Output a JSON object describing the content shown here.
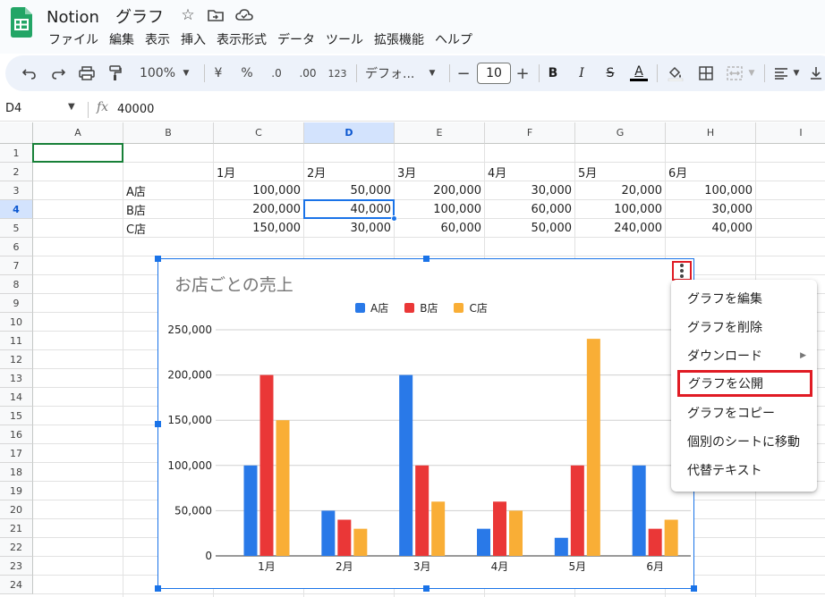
{
  "app": {
    "title": "Notion　グラフ",
    "menu": [
      "ファイル",
      "編集",
      "表示",
      "挿入",
      "表示形式",
      "データ",
      "ツール",
      "拡張機能",
      "ヘルプ"
    ]
  },
  "toolbar": {
    "zoom": "100%",
    "currency": "¥",
    "percent": "%",
    "dec_decrease": ".0",
    "dec_increase": ".00",
    "number_format": "123",
    "font": "デフォ...",
    "font_size": "10",
    "minus": "−",
    "plus": "+",
    "bold": "B",
    "italic": "I",
    "strike": "S",
    "text_color": "A"
  },
  "formula_bar": {
    "cell_ref": "D4",
    "fx": "fx",
    "value": "40000"
  },
  "sheet": {
    "columns": [
      "A",
      "B",
      "C",
      "D",
      "E",
      "F",
      "G",
      "H",
      "I"
    ],
    "rows": [
      "1",
      "2",
      "3",
      "4",
      "5",
      "6",
      "7",
      "8",
      "9",
      "10",
      "11",
      "12",
      "13",
      "14",
      "15",
      "16",
      "17",
      "18",
      "19",
      "20",
      "21",
      "22",
      "23",
      "24"
    ],
    "header_row": [
      "1月",
      "2月",
      "3月",
      "4月",
      "5月",
      "6月"
    ],
    "data_rows": [
      {
        "label": "A店",
        "values": [
          "100,000",
          "50,000",
          "200,000",
          "30,000",
          "20,000",
          "100,000"
        ]
      },
      {
        "label": "B店",
        "values": [
          "200,000",
          "40,000",
          "100,000",
          "60,000",
          "100,000",
          "30,000"
        ]
      },
      {
        "label": "C店",
        "values": [
          "150,000",
          "30,000",
          "60,000",
          "50,000",
          "240,000",
          "40,000"
        ]
      }
    ]
  },
  "chart_data": {
    "type": "bar",
    "title": "お店ごとの売上",
    "categories": [
      "1月",
      "2月",
      "3月",
      "4月",
      "5月",
      "6月"
    ],
    "series": [
      {
        "name": "A店",
        "values": [
          100000,
          50000,
          200000,
          30000,
          20000,
          100000
        ],
        "color": "#2979e8"
      },
      {
        "name": "B店",
        "values": [
          200000,
          40000,
          100000,
          60000,
          100000,
          30000
        ],
        "color": "#ea3737"
      },
      {
        "name": "C店",
        "values": [
          150000,
          30000,
          60000,
          50000,
          240000,
          40000
        ],
        "color": "#f9ae36"
      }
    ],
    "ylim": [
      0,
      250000
    ],
    "y_ticks": [
      "0",
      "50,000",
      "100,000",
      "150,000",
      "200,000",
      "250,000"
    ],
    "legend_position": "top",
    "grid": true
  },
  "context_menu": {
    "items": [
      "グラフを編集",
      "グラフを削除",
      "ダウンロード",
      "グラフを公開",
      "グラフをコピー",
      "個別のシートに移動",
      "代替テキスト"
    ],
    "submenu_arrow": "▶"
  },
  "colors": {
    "accent": "#1a73e8",
    "highlight": "#e01b24",
    "sheets_green": "#188038"
  }
}
